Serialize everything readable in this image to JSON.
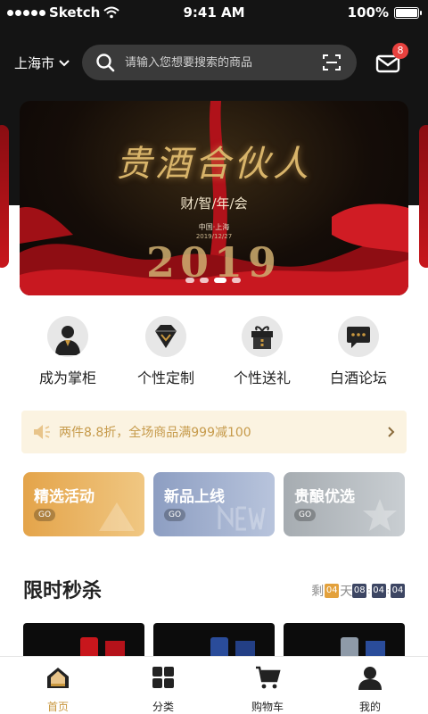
{
  "status_bar": {
    "carrier": "Sketch",
    "time": "9:41 AM",
    "battery": "100%",
    "battery_level": 1.0
  },
  "header": {
    "city": "上海市",
    "search_placeholder": "请输入您想要搜索的商品",
    "mail_badge": "8"
  },
  "banner": {
    "title": "贵酒合伙人",
    "subtitle": "财/智/年/会",
    "location": "中国·上海",
    "date": "2019/12/27",
    "year": "2019",
    "page_count": 4,
    "active_page": 2
  },
  "entries": [
    {
      "label": "成为掌柜",
      "icon": "shopkeeper-icon"
    },
    {
      "label": "个性定制",
      "icon": "custom-gem-icon"
    },
    {
      "label": "个性送礼",
      "icon": "gift-icon"
    },
    {
      "label": "白酒论坛",
      "icon": "forum-chat-icon"
    }
  ],
  "notice": {
    "text": "两件8.8折，全场商品满999减100",
    "icon": "speaker-icon"
  },
  "promos": [
    {
      "title": "精选活动",
      "go": "GO",
      "color": "#e4a44a"
    },
    {
      "title": "新品上线",
      "go": "GO",
      "color": "#8d9ec2"
    },
    {
      "title": "贵酿优选",
      "go": "GO",
      "color": "#a6acb1"
    }
  ],
  "flash_sale": {
    "title": "限时秒杀",
    "remaining_label": "剩",
    "days": "04",
    "days_label": "天",
    "hours": "08",
    "minutes": "04",
    "seconds": "04"
  },
  "tabs": [
    {
      "label": "首页",
      "icon": "home-icon",
      "active": true
    },
    {
      "label": "分类",
      "icon": "category-icon",
      "active": false
    },
    {
      "label": "购物车",
      "icon": "cart-icon",
      "active": false
    },
    {
      "label": "我的",
      "icon": "profile-icon",
      "active": false
    }
  ],
  "colors": {
    "accent_gold": "#c8973e",
    "header_dark": "#141414",
    "badge_red": "#e8413e",
    "countdown_navy": "#3d4663"
  }
}
